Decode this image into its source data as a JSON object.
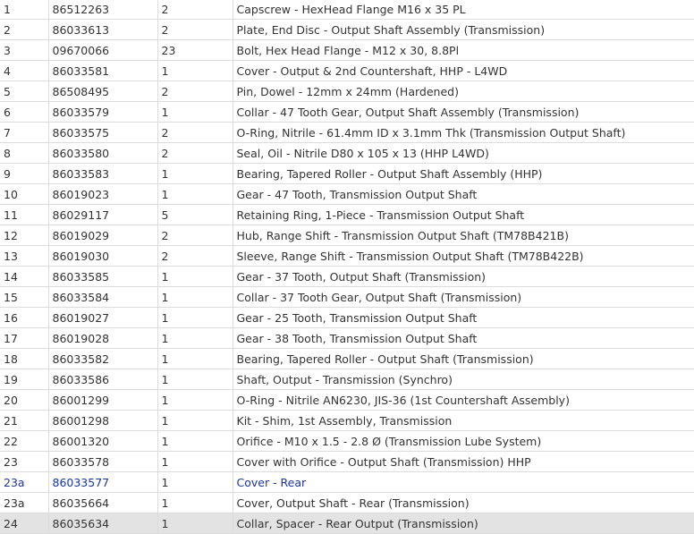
{
  "rows": [
    {
      "pos": "1",
      "part_no": "86512263",
      "qty": "2",
      "desc": "Capscrew - HexHead Flange M16 x 35 PL"
    },
    {
      "pos": "2",
      "part_no": "86033613",
      "qty": "2",
      "desc": "Plate, End Disc - Output Shaft Assembly (Transmission)"
    },
    {
      "pos": "3",
      "part_no": "09670066",
      "qty": "23",
      "desc": "Bolt, Hex Head Flange - M12 x 30, 8.8Pl"
    },
    {
      "pos": "4",
      "part_no": "86033581",
      "qty": "1",
      "desc": "Cover - Output & 2nd Countershaft, HHP - L4WD"
    },
    {
      "pos": "5",
      "part_no": "86508495",
      "qty": "2",
      "desc": "Pin, Dowel - 12mm x 24mm (Hardened)"
    },
    {
      "pos": "6",
      "part_no": "86033579",
      "qty": "1",
      "desc": "Collar - 47 Tooth Gear, Output Shaft Assembly (Transmission)"
    },
    {
      "pos": "7",
      "part_no": "86033575",
      "qty": "2",
      "desc": "O-Ring, Nitrile - 61.4mm ID x 3.1mm Thk (Transmission Output Shaft)"
    },
    {
      "pos": "8",
      "part_no": "86033580",
      "qty": "2",
      "desc": "Seal, Oil - Nitrile D80 x 105 x 13 (HHP L4WD)"
    },
    {
      "pos": "9",
      "part_no": "86033583",
      "qty": "1",
      "desc": "Bearing, Tapered Roller - Output Shaft Assembly (HHP)"
    },
    {
      "pos": "10",
      "part_no": "86019023",
      "qty": "1",
      "desc": "Gear - 47 Tooth, Transmission Output Shaft"
    },
    {
      "pos": "11",
      "part_no": "86029117",
      "qty": "5",
      "desc": "Retaining Ring, 1-Piece - Transmission Output Shaft"
    },
    {
      "pos": "12",
      "part_no": "86019029",
      "qty": "2",
      "desc": "Hub, Range Shift - Transmission Output Shaft (TM78B421B)"
    },
    {
      "pos": "13",
      "part_no": "86019030",
      "qty": "2",
      "desc": "Sleeve, Range Shift - Transmission Output Shaft (TM78B422B)"
    },
    {
      "pos": "14",
      "part_no": "86033585",
      "qty": "1",
      "desc": "Gear - 37 Tooth, Output Shaft (Transmission)"
    },
    {
      "pos": "15",
      "part_no": "86033584",
      "qty": "1",
      "desc": "Collar - 37 Tooth Gear, Output Shaft (Transmission)"
    },
    {
      "pos": "16",
      "part_no": "86019027",
      "qty": "1",
      "desc": "Gear - 25 Tooth, Transmission Output Shaft"
    },
    {
      "pos": "17",
      "part_no": "86019028",
      "qty": "1",
      "desc": "Gear - 38 Tooth, Transmission Output Shaft"
    },
    {
      "pos": "18",
      "part_no": "86033582",
      "qty": "1",
      "desc": "Bearing, Tapered Roller - Output Shaft (Transmission)"
    },
    {
      "pos": "19",
      "part_no": "86033586",
      "qty": "1",
      "desc": "Shaft, Output - Transmission (Synchro)"
    },
    {
      "pos": "20",
      "part_no": "86001299",
      "qty": "1",
      "desc": "O-Ring - Nitrile AN6230, JIS-36 (1st Countershaft Assembly)"
    },
    {
      "pos": "21",
      "part_no": "86001298",
      "qty": "1",
      "desc": "Kit - Shim, 1st Assembly, Transmission"
    },
    {
      "pos": "22",
      "part_no": "86001320",
      "qty": "1",
      "desc": "Orifice - M10 x 1.5 - 2.8 Ø (Transmission Lube System)"
    },
    {
      "pos": "23",
      "part_no": "86033578",
      "qty": "1",
      "desc": "Cover with Orifice - Output Shaft (Transmission) HHP"
    },
    {
      "pos": "23a",
      "part_no": "86033577",
      "qty": "1",
      "desc": "Cover - Rear"
    },
    {
      "pos": "23a",
      "part_no": "86035664",
      "qty": "1",
      "desc": "Cover, Output Shaft - Rear (Transmission)"
    },
    {
      "pos": "24",
      "part_no": "86035634",
      "qty": "1",
      "desc": "Collar, Spacer - Rear Output (Transmission)"
    }
  ],
  "link_color": "#1a33a6",
  "highlight_color": "#e3e3e3"
}
